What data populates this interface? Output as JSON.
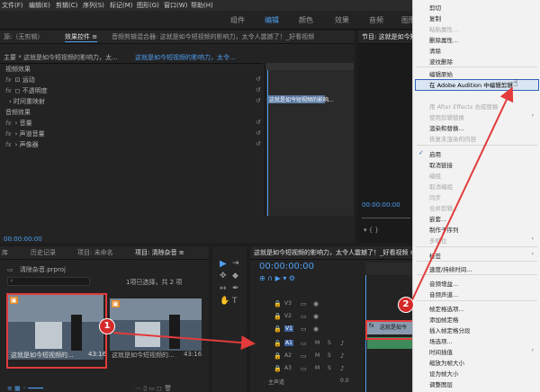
{
  "menubar": [
    "文件(F)",
    "编辑(E)",
    "剪辑(C)",
    "序列(S)",
    "标记(M)",
    "图形(G)",
    "窗口(W)",
    "帮助(H)"
  ],
  "workspaces": [
    "组件",
    "编辑",
    "颜色",
    "效果",
    "音频",
    "图形"
  ],
  "source_panel": {
    "source_tab": "源:（无剪辑）",
    "effect_controls_tab": "效果控件 ≡",
    "mixer_tab": "音频剪辑混合器: 这就是如今短视频的影响力，太令人震撼了！_好看视频",
    "master_label": "主要 * 这就是如今短视频的影响力，太...",
    "seq_label": "这就是如今短视频的影响力，太令...",
    "clip_label": "这就是如今短视频的影响...",
    "video_effects": "视频效果",
    "motion": "运动",
    "opacity": "不透明度",
    "time_remap": "时间重映射",
    "audio_effects": "音频效果",
    "volume": "音量",
    "channel_volume": "声道音量",
    "panner": "声像器",
    "timecode": "00:00:00:00"
  },
  "program_panel": {
    "title": "节目: 这就是如今短视频的影响力，太令人震撼了！_好看视频",
    "timecode": "00:00:00:00"
  },
  "project_panel": {
    "tabs": [
      "库",
      "历史记录",
      "项目: 未命名",
      "项目: 清除杂音 ≡"
    ],
    "file": "清除杂音.prproj",
    "selection": "1项已选择，共 2 项",
    "clip1_name": "这就是如今短视频的...",
    "clip1_dur": "43:16",
    "clip2_name": "这就是如今短视频的...",
    "clip2_dur": "43:16"
  },
  "timeline": {
    "title": "这就是如今短视频的影响力，太令人震撼了！_好看视频 ≡",
    "timecode": "00:00:00:00",
    "video_tracks": [
      "V3",
      "V2",
      "V1"
    ],
    "audio_tracks": [
      "A1",
      "A2",
      "A3"
    ],
    "master": "主声道",
    "master_value": "0.0",
    "clip_label": "这就是如今",
    "track_m": "M",
    "track_s": "S"
  },
  "context_menu": {
    "items": [
      {
        "label": "剪切",
        "dis": false
      },
      {
        "label": "复制",
        "dis": false
      },
      {
        "label": "粘贴属性...",
        "dis": true
      },
      {
        "label": "删除属性...",
        "dis": false
      },
      {
        "label": "清除",
        "dis": false
      },
      {
        "label": "波纹删除",
        "dis": false
      },
      {
        "label": "编辑原始",
        "dis": false
      },
      {
        "label": "在 Adobe Audition 中编辑剪辑",
        "dis": false
      },
      {
        "label": "用 After Effects 合成替换",
        "dis": true
      },
      {
        "label": "使用剪辑替换",
        "dis": true
      },
      {
        "label": "渲染和替换...",
        "dis": false
      },
      {
        "label": "恢复未渲染的内容",
        "dis": true
      },
      {
        "label": "启用",
        "dis": false
      },
      {
        "label": "取消链接",
        "dis": false
      },
      {
        "label": "编组",
        "dis": true
      },
      {
        "label": "取消编组",
        "dis": true
      },
      {
        "label": "同步",
        "dis": true
      },
      {
        "label": "合并剪辑...",
        "dis": true
      },
      {
        "label": "嵌套...",
        "dis": false
      },
      {
        "label": "制作子序列",
        "dis": false
      },
      {
        "label": "多机位",
        "dis": true
      },
      {
        "label": "标签",
        "dis": false
      },
      {
        "label": "速度/持续时间...",
        "dis": false
      },
      {
        "label": "音频增益...",
        "dis": false
      },
      {
        "label": "音频声道...",
        "dis": false
      },
      {
        "label": "帧定格选项...",
        "dis": false
      },
      {
        "label": "添加帧定格",
        "dis": false
      },
      {
        "label": "插入帧定格分段",
        "dis": false
      },
      {
        "label": "场选项...",
        "dis": false
      },
      {
        "label": "时间插值",
        "dis": false
      },
      {
        "label": "缩放为帧大小",
        "dis": false
      },
      {
        "label": "设为帧大小",
        "dis": false
      },
      {
        "label": "调整图层",
        "dis": false
      }
    ],
    "check": "✓",
    "submenu_arrow": "›"
  },
  "annotations": {
    "badge1": "1",
    "badge2": "2"
  },
  "colors": {
    "accent": "#4f9ef0",
    "highlight_border": "#e23b3b",
    "menu_highlight": "#2f64b8"
  }
}
